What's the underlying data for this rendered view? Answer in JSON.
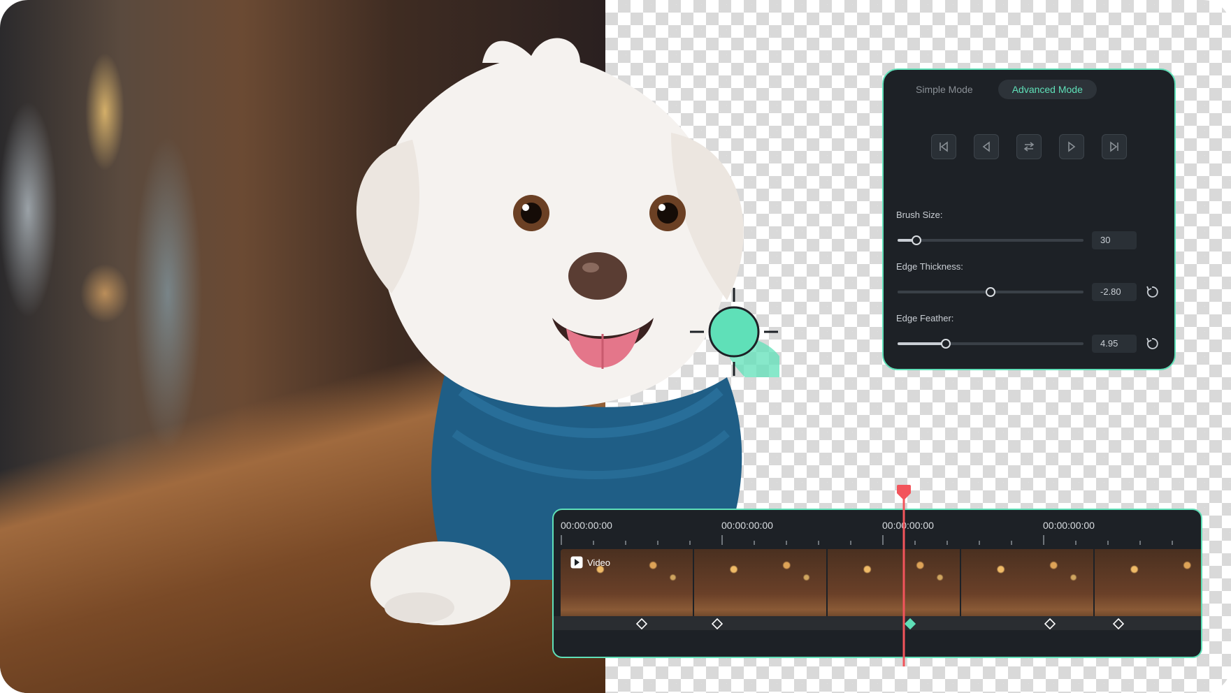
{
  "panel": {
    "tabs": [
      {
        "label": "Simple Mode",
        "active": false
      },
      {
        "label": "Advanced Mode",
        "active": true
      }
    ],
    "nav_buttons": [
      "skip-to-start-icon",
      "step-back-icon",
      "swap-icon",
      "step-forward-icon",
      "skip-to-end-icon"
    ],
    "controls": {
      "brush_size": {
        "label": "Brush Size:",
        "value": "30",
        "level": 0.1
      },
      "edge_thickness": {
        "label": "Edge Thickness:",
        "value": "-2.80",
        "level": 0.5
      },
      "edge_feather": {
        "label": "Edge Feather:",
        "value": "4.95",
        "level": 0.26
      }
    }
  },
  "timeline": {
    "timecodes": [
      "00:00:00:00",
      "00:00:00:00",
      "00:00:00:00",
      "00:00:00:00"
    ],
    "track_label": "Video",
    "track_icon": "play-icon"
  },
  "colors": {
    "accent": "#5fe0b8",
    "panel_bg": "#1d2126",
    "playhead": "#f2545b"
  }
}
